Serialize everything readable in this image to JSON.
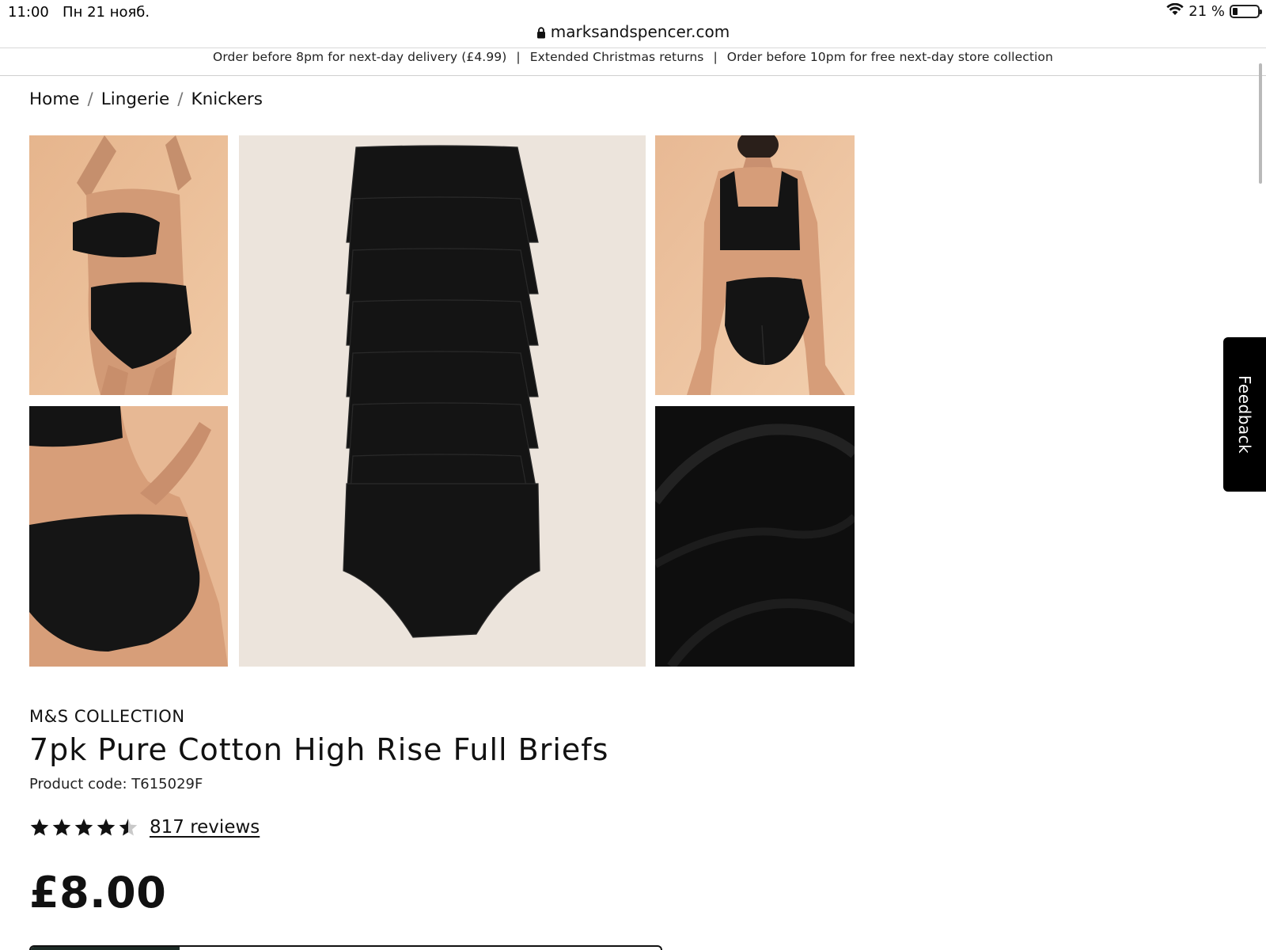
{
  "status_bar": {
    "time": "11:00",
    "date": "Пн 21 нояб.",
    "battery": "21 %",
    "icons": [
      "wifi-icon",
      "battery-icon"
    ]
  },
  "browser": {
    "url": "marksandspencer.com",
    "icons": [
      "lock-icon"
    ]
  },
  "promo": {
    "items": [
      "Order before 8pm for next-day delivery (£4.99)",
      "Extended Christmas returns",
      "Order before 10pm for free next-day store collection"
    ],
    "separator": "|"
  },
  "breadcrumb": {
    "items": [
      "Home",
      "Lingerie",
      "Knickers"
    ],
    "separator": "/"
  },
  "gallery": {
    "images": [
      "model-front-photo",
      "model-side-closeup-photo",
      "seven-pack-flatlay-photo",
      "model-back-photo",
      "fabric-closeup-photo"
    ]
  },
  "feedback": {
    "label": "Feedback"
  },
  "product": {
    "brand": "M&S COLLECTION",
    "title": "7pk Pure Cotton High Rise Full Briefs",
    "code": "Product code: T615029F",
    "rating": 4.5,
    "rating_max": 5,
    "reviews": "817 reviews",
    "price": "£8.00"
  },
  "colors": {
    "background": "#ffffff",
    "text": "#111111",
    "feedback_bg": "#000000",
    "photo_bg_warm": "#e9b892",
    "photo_bg_neutral": "#ece4dc",
    "garment": "#141414"
  }
}
